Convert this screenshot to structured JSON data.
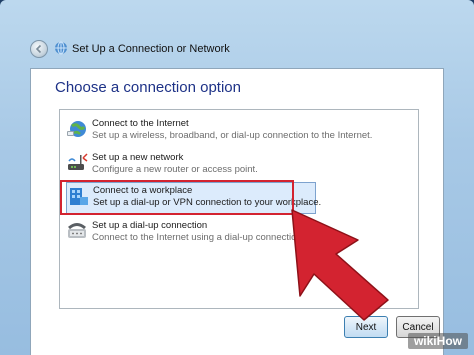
{
  "window": {
    "title": "Set Up a Connection or Network",
    "heading": "Choose a connection option"
  },
  "options": [
    {
      "title": "Connect to the Internet",
      "description": "Set up a wireless, broadband, or dial-up connection to the Internet.",
      "icon": "globe-network-icon"
    },
    {
      "title": "Set up a new network",
      "description": "Configure a new router or access point.",
      "icon": "router-icon"
    },
    {
      "title": "Connect to a workplace",
      "description": "Set up a dial-up or VPN connection to your workplace.",
      "icon": "workplace-building-icon",
      "selected": true
    },
    {
      "title": "Set up a dial-up connection",
      "description": "Connect to the Internet using a dial-up connection.",
      "icon": "telephone-icon"
    }
  ],
  "buttons": {
    "next": "Next",
    "cancel": "Cancel"
  },
  "watermark": {
    "wiki": "wiki",
    "how": "How"
  },
  "colors": {
    "accent_red": "#d32330",
    "heading_blue": "#1e3287",
    "selection_bg": "#dcebfc"
  }
}
